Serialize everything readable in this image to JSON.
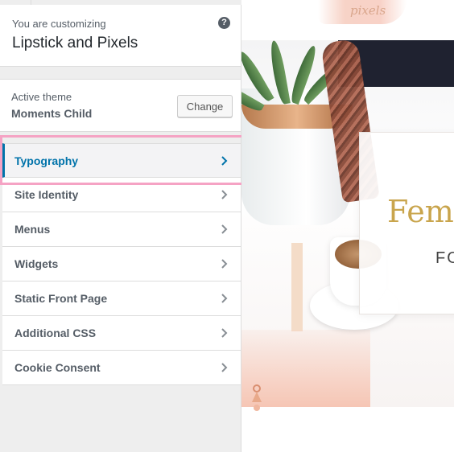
{
  "customizer": {
    "info": {
      "pre_title": "You are customizing",
      "site_title": "Lipstick and Pixels",
      "help_icon": "question-mark-icon"
    },
    "theme": {
      "label": "Active theme",
      "name": "Moments Child",
      "change_label": "Change"
    },
    "sections": [
      {
        "label": "Typography",
        "active": true
      },
      {
        "label": "Site Identity",
        "active": false
      },
      {
        "label": "Menus",
        "active": false
      },
      {
        "label": "Widgets",
        "active": false
      },
      {
        "label": "Static Front Page",
        "active": false
      },
      {
        "label": "Additional CSS",
        "active": false
      },
      {
        "label": "Cookie Consent",
        "active": false
      }
    ],
    "icons": {
      "section_arrow": "chevron-right-icon"
    }
  },
  "preview": {
    "logo_text": "pixels",
    "hero_heading": "Fem",
    "hero_subheading": "FO"
  },
  "colors": {
    "accent": "#0073aa",
    "highlight": "#f5a3c4",
    "gold": "#c9a54d"
  }
}
